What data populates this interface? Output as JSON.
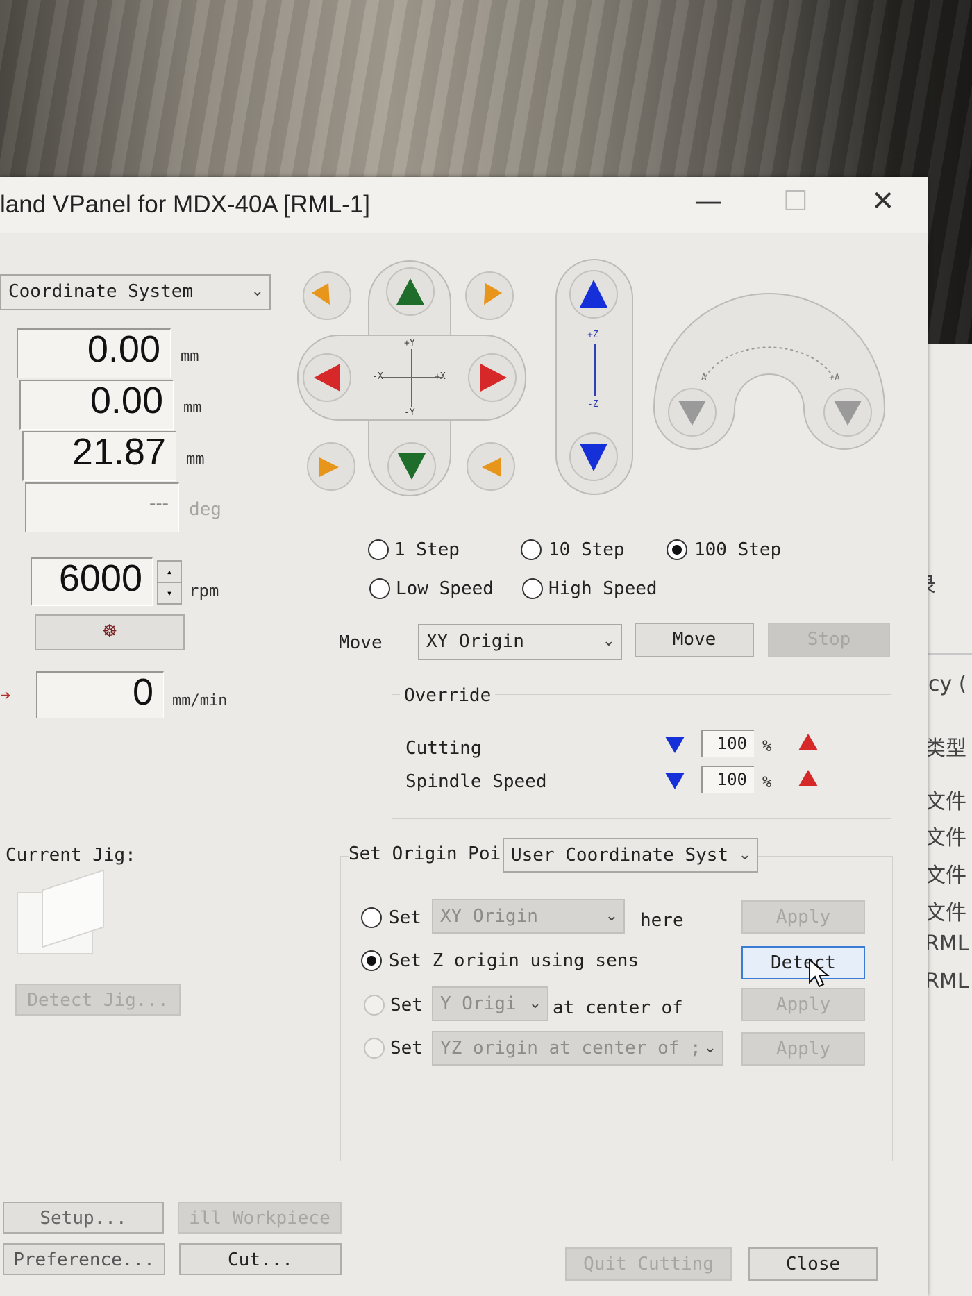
{
  "window": {
    "title": "land VPanel for MDX-40A [RML-1]",
    "minimize": "—",
    "maximize": "☐",
    "close": "✕"
  },
  "coordinates": {
    "system": "Coordinate System",
    "x": {
      "value": "0.00",
      "unit": "mm"
    },
    "y": {
      "value": "0.00",
      "unit": "mm"
    },
    "z": {
      "value": "21.87",
      "unit": "mm"
    },
    "a": {
      "value": "---",
      "unit": "deg"
    }
  },
  "spindle": {
    "value": "6000",
    "unit": "rpm",
    "button_glyph": "☸"
  },
  "feed": {
    "value": "0",
    "unit": "mm/min"
  },
  "jog": {
    "xy_labels": {
      "py": "+Y",
      "ny": "-Y",
      "nx": "-X",
      "px": "+X"
    },
    "z_labels": {
      "pz": "+Z",
      "nz": "-Z"
    },
    "a_labels": {
      "na": "-A",
      "pa": "+A"
    }
  },
  "step": {
    "options": [
      "1 Step",
      "10 Step",
      "100 Step"
    ],
    "selected": "100 Step",
    "speed_options": [
      "Low Speed",
      "High Speed"
    ]
  },
  "move": {
    "label": "Move",
    "target": "XY Origin",
    "move_button": "Move",
    "stop_button": "Stop"
  },
  "override": {
    "title": "Override",
    "cutting": {
      "label": "Cutting",
      "value": "100",
      "unit": "%"
    },
    "spindle": {
      "label": "Spindle Speed",
      "value": "100",
      "unit": "%"
    }
  },
  "jig": {
    "label": "Current Jig:",
    "detect_button": "Detect Jig..."
  },
  "origin": {
    "label": "Set Origin Poi",
    "system": "User Coordinate Syst",
    "rows": [
      {
        "prefix": "Set",
        "combo": "XY Origin",
        "suffix": "here",
        "button": "Apply"
      },
      {
        "text": "Set Z origin using sens",
        "button": "Detect"
      },
      {
        "prefix": "Set",
        "combo": "Y Origi",
        "suffix": "at center of",
        "button": "Apply"
      },
      {
        "prefix": "Set",
        "combo": "YZ origin at center of ;",
        "button": "Apply"
      }
    ]
  },
  "bottom": {
    "setup": "Setup...",
    "fill": "ill Workpiece",
    "preference": "Preference...",
    "cut": "Cut...",
    "quit": "Quit Cutting",
    "close": "Close"
  },
  "side_window": {
    "lines": [
      "录",
      "ncy (",
      "类型",
      "文件",
      "文件",
      "文件",
      "文件",
      "RML",
      "RML"
    ]
  },
  "colors": {
    "jog_green": "#1f6d2a",
    "jog_red": "#d62828",
    "jog_orange": "#e8951c",
    "jog_blue": "#1530d8",
    "override_up": "#d62828",
    "override_down": "#1530d8",
    "focus_blue": "#3a7bd5"
  }
}
